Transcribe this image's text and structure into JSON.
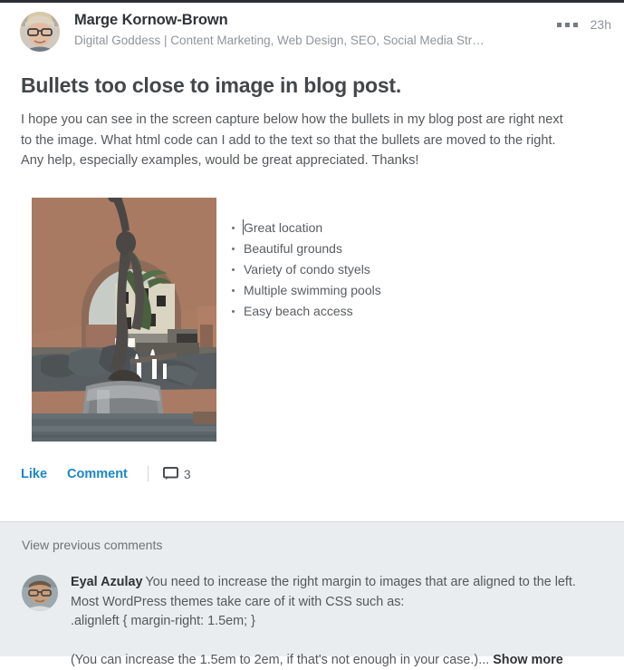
{
  "post": {
    "author": {
      "name": "Marge Kornow-Brown",
      "headline": "Digital Goddess | Content Marketing, Web Design, SEO, Social Media Str…",
      "avatar_icon": "user-photo-avatar"
    },
    "menu_icon": "overflow-menu-icon",
    "timestamp": "23h",
    "title": "Bullets too close to image in blog post.",
    "body": "I hope you can see in the screen capture below how the bullets in my blog post are right next to the image. What html code can I add to the text so that the bullets are moved to the right. Any help, especially examples, would be great appreciated. Thanks!",
    "embedded_screenshot": {
      "photo_alt": "bronze-statue-fountain-photo",
      "bullets": [
        "Great location",
        "Beautiful grounds",
        "Variety of condo styels",
        "Multiple swimming pools",
        "Easy beach access"
      ]
    },
    "actions": {
      "like_label": "Like",
      "comment_label": "Comment",
      "comment_icon": "comment-bubble-icon",
      "comment_count": "3"
    }
  },
  "comments": {
    "view_previous_label": "View previous comments",
    "items": [
      {
        "avatar_icon": "user-photo-avatar",
        "author": "Eyal Azulay",
        "line1": "You need to increase the right margin to images that are aligned to the left.",
        "line2": "Most WordPress themes take care of it with CSS such as:",
        "code": ".alignleft { margin-right: 1.5em; }",
        "line3": "(You can increase the 1.5em to 2em, if that's not enough in your case.)...",
        "show_more_label": "Show more"
      }
    ]
  },
  "colors": {
    "link_blue": "#1b86c8",
    "comments_bg": "#e9edf0",
    "text_dark": "#2f3337",
    "text_muted": "#8f9499"
  }
}
